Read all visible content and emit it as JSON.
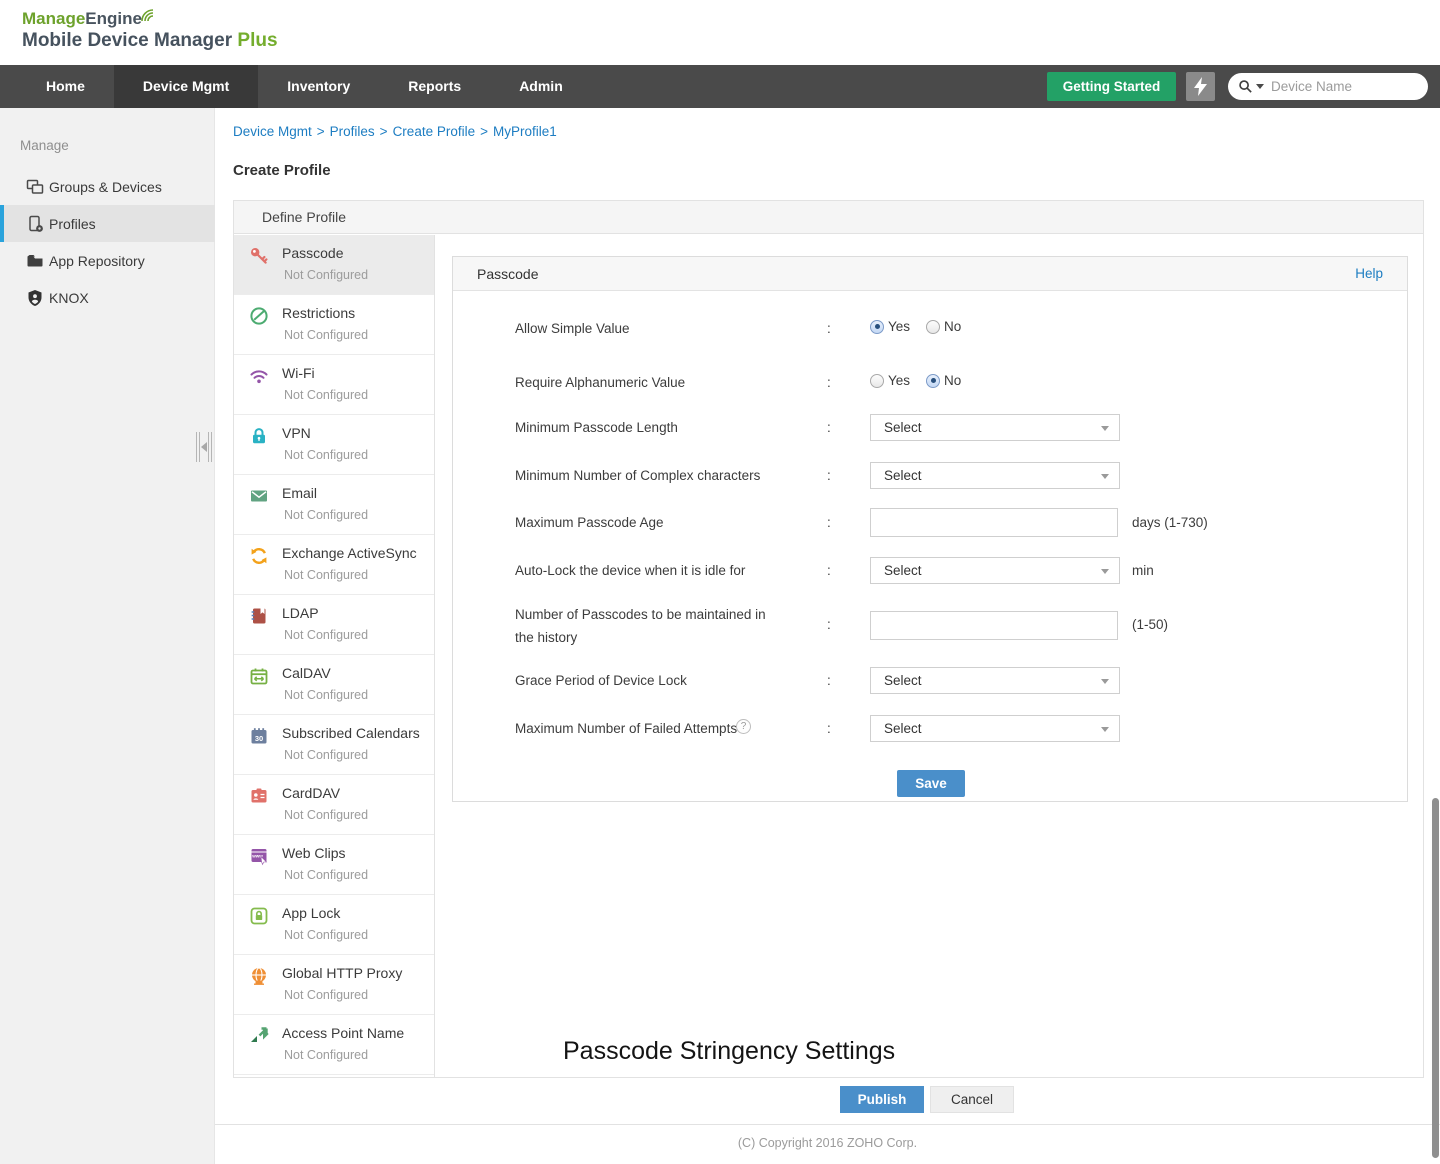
{
  "colors": {
    "brand_green": "#6da22c",
    "brand_dark": "#46525e",
    "nav_bg": "#4a4a4a",
    "nav_active_bg": "#393939",
    "getting_started_green": "#23a166",
    "primary_button_blue": "#4a8fca",
    "link_blue": "#1d7dc2",
    "sidebar_bg": "#f1f1f1",
    "sidebar_active_bar": "#2aa3dc"
  },
  "brand": {
    "name_part1": "Manage",
    "name_part2": "Engine",
    "product": "Mobile Device Manager",
    "product_suffix": "Plus"
  },
  "nav": {
    "tabs": [
      "Home",
      "Device Mgmt",
      "Inventory",
      "Reports",
      "Admin"
    ],
    "active_tab": "Device Mgmt",
    "getting_started_label": "Getting Started",
    "search_placeholder": "Device Name"
  },
  "sidebar": {
    "section_label": "Manage",
    "items": [
      {
        "label": "Groups & Devices",
        "icon": "devices-icon"
      },
      {
        "label": "Profiles",
        "icon": "profile-phone-icon"
      },
      {
        "label": "App Repository",
        "icon": "folder-icon"
      },
      {
        "label": "KNOX",
        "icon": "shield-icon"
      }
    ],
    "active_item": "Profiles"
  },
  "breadcrumb": {
    "items": [
      "Device Mgmt",
      "Profiles",
      "Create Profile",
      "MyProfile1"
    ],
    "separator": ">"
  },
  "page": {
    "title": "Create Profile"
  },
  "define_profile": {
    "tab_label": "Define Profile",
    "sections": [
      {
        "label": "Passcode",
        "status": "Not Configured",
        "icon": "key-icon",
        "color": "#e0716a"
      },
      {
        "label": "Restrictions",
        "status": "Not Configured",
        "icon": "no-entry-icon",
        "color": "#4cab71"
      },
      {
        "label": "Wi-Fi",
        "status": "Not Configured",
        "icon": "wifi-icon",
        "color": "#9455a8"
      },
      {
        "label": "VPN",
        "status": "Not Configured",
        "icon": "lock-icon",
        "color": "#2ab2c4"
      },
      {
        "label": "Email",
        "status": "Not Configured",
        "icon": "envelope-icon",
        "color": "#61a382"
      },
      {
        "label": "Exchange ActiveSync",
        "status": "Not Configured",
        "icon": "sync-icon",
        "color": "#f3a21b"
      },
      {
        "label": "LDAP",
        "status": "Not Configured",
        "icon": "address-book-icon",
        "color": "#ad5146"
      },
      {
        "label": "CalDAV",
        "status": "Not Configured",
        "icon": "calendar-arrows-icon",
        "color": "#76b043"
      },
      {
        "label": "Subscribed Calendars",
        "status": "Not Configured",
        "icon": "calendar-30-icon",
        "color": "#6d7f9e"
      },
      {
        "label": "CardDAV",
        "status": "Not Configured",
        "icon": "contact-card-icon",
        "color": "#e0716a"
      },
      {
        "label": "Web Clips",
        "status": "Not Configured",
        "icon": "web-window-icon",
        "color": "#9455a8"
      },
      {
        "label": "App Lock",
        "status": "Not Configured",
        "icon": "app-lock-icon",
        "color": "#84bb4c"
      },
      {
        "label": "Global HTTP Proxy",
        "status": "Not Configured",
        "icon": "globe-icon",
        "color": "#ef8f35"
      },
      {
        "label": "Access Point Name",
        "status": "Not Configured",
        "icon": "apn-arrows-icon",
        "color": "#50996b"
      }
    ]
  },
  "panel": {
    "title": "Passcode",
    "help_label": "Help",
    "help_icon": "?",
    "colon": ":",
    "save_label": "Save",
    "rows": [
      {
        "label": "Allow Simple Value",
        "type": "radio",
        "options": [
          "Yes",
          "No"
        ],
        "selected": "Yes"
      },
      {
        "label": "Require Alphanumeric Value",
        "type": "radio",
        "options": [
          "Yes",
          "No"
        ],
        "selected": "No"
      },
      {
        "label": "Minimum Passcode Length",
        "type": "select",
        "value": "Select"
      },
      {
        "label": "Minimum Number of Complex characters",
        "type": "select",
        "value": "Select"
      },
      {
        "label": "Maximum Passcode Age",
        "type": "input",
        "value": "",
        "suffix": "days (1-730)"
      },
      {
        "label": "Auto-Lock the device when it is idle for",
        "type": "select",
        "value": "Select",
        "suffix": "min"
      },
      {
        "label": "Number of Passcodes to be maintained in the history",
        "type": "input",
        "value": "",
        "suffix": "(1-50)"
      },
      {
        "label": "Grace Period of Device Lock",
        "type": "select",
        "value": "Select"
      },
      {
        "label": "Maximum Number of Failed Attempts",
        "type": "select",
        "value": "Select",
        "has_help": true
      }
    ]
  },
  "stringency_heading": "Passcode Stringency Settings",
  "footer_actions": {
    "publish_label": "Publish",
    "cancel_label": "Cancel"
  },
  "footer": {
    "copyright": "(C) Copyright 2016 ZOHO Corp."
  }
}
